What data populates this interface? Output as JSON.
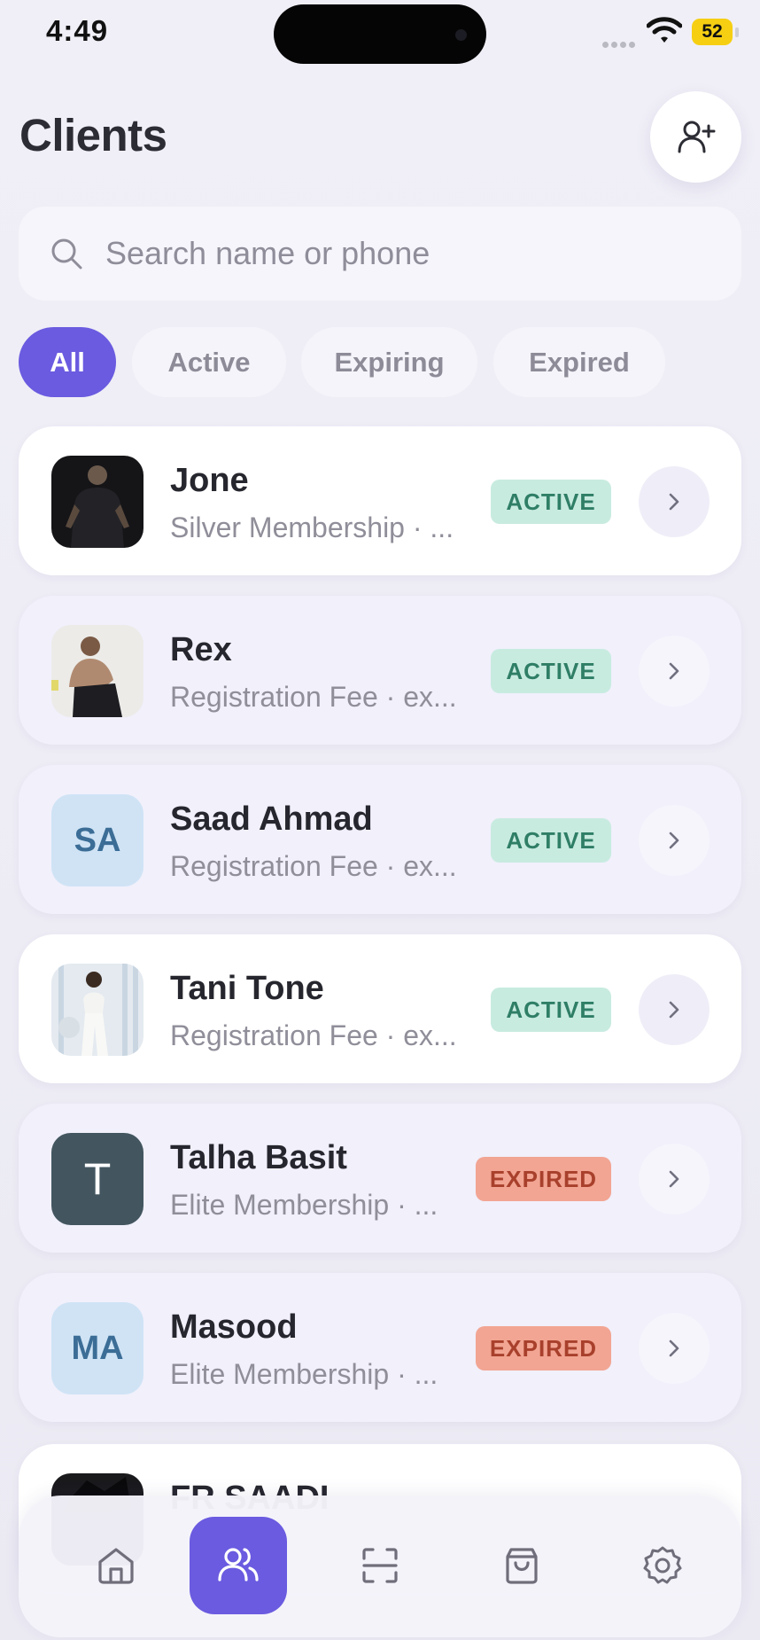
{
  "status_bar": {
    "time": "4:49",
    "battery": "52"
  },
  "header": {
    "title": "Clients",
    "add_icon": "user-plus-icon"
  },
  "search": {
    "placeholder": "Search name or phone",
    "value": "",
    "icon": "search-icon"
  },
  "filters": {
    "items": [
      "All",
      "Active",
      "Expiring",
      "Expired"
    ],
    "selected": "All"
  },
  "clients": [
    {
      "name": "Jone",
      "plan": "Silver Membership · ...",
      "status": "ACTIVE",
      "avatar": "photo"
    },
    {
      "name": "Rex",
      "plan": "Registration Fee · ex...",
      "status": "ACTIVE",
      "avatar": "photo"
    },
    {
      "name": "Saad Ahmad",
      "plan": "Registration Fee · ex...",
      "status": "ACTIVE",
      "avatar_initials": "SA"
    },
    {
      "name": "Tani Tone",
      "plan": "Registration Fee · ex...",
      "status": "ACTIVE",
      "avatar": "photo"
    },
    {
      "name": "Talha Basit",
      "plan": "Elite Membership · ...",
      "status": "EXPIRED",
      "avatar_initials": "T"
    },
    {
      "name": "Masood",
      "plan": "Elite Membership · ...",
      "status": "EXPIRED",
      "avatar_initials": "MA"
    },
    {
      "name": "FR SAADI",
      "plan": "",
      "status": "",
      "avatar": "photo"
    }
  ],
  "colors": {
    "accent": "#6a5be0",
    "active_badge": "#c8ebe0",
    "expired_badge": "#f2a593"
  },
  "bottom_nav": {
    "items": [
      "home-icon",
      "clients-icon",
      "scan-icon",
      "shopping-bag-icon",
      "settings-icon"
    ],
    "selected": "clients-icon"
  }
}
